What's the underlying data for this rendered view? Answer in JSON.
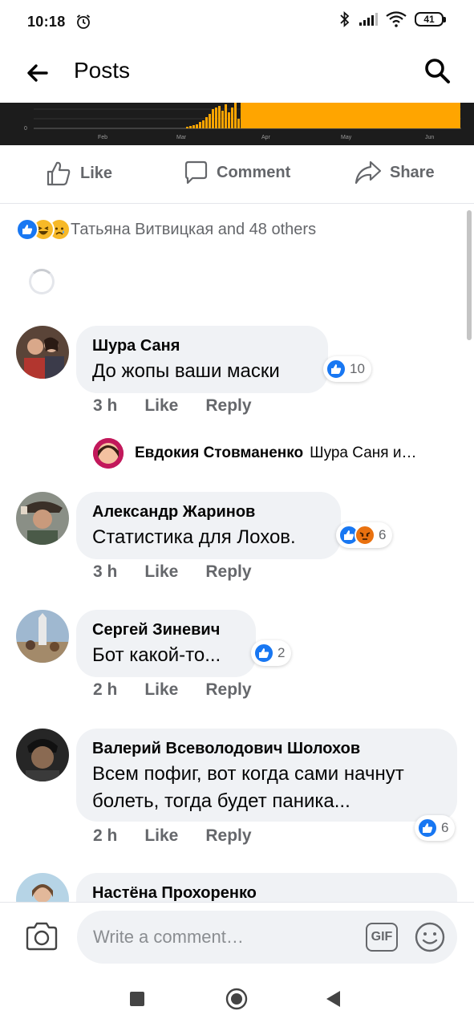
{
  "status_bar": {
    "time": "10:18",
    "battery": "41",
    "icons": [
      "alarm-icon",
      "bluetooth-icon",
      "signal-icon",
      "wifi-icon",
      "battery-icon"
    ]
  },
  "app_bar": {
    "title": "Posts",
    "icons": [
      "back-arrow-icon",
      "search-icon"
    ]
  },
  "chart_data": {
    "type": "bar",
    "title": "",
    "xlabel": "",
    "ylabel": "",
    "tick_labels_x": [
      "Feb",
      "Mar",
      "Apr",
      "May",
      "Jun"
    ],
    "tick_labels_y": [
      "0"
    ],
    "colors": {
      "bars": "#FFA500",
      "background": "#1c1c1c",
      "grid": "#3a3a3a"
    }
  },
  "actions": {
    "like": "Like",
    "comment": "Comment",
    "share": "Share"
  },
  "reactions_summary": {
    "text": "Татьяна Витвицкая and 48 others",
    "icons": [
      "like-reaction-icon",
      "haha-reaction-icon",
      "sad-reaction-icon"
    ]
  },
  "comments": [
    {
      "author": "Шура Саня",
      "text": "До жопы ваши маски",
      "time": "3 h",
      "like": "Like",
      "reply": "Reply",
      "reaction_count": "10",
      "reactions": [
        "like"
      ],
      "replies": [
        {
          "author": "Евдокия Стовманенко",
          "text": "Шура Саня и…"
        }
      ]
    },
    {
      "author": "Александр Жаринов",
      "text": "Статистика для Лохов.",
      "time": "3 h",
      "like": "Like",
      "reply": "Reply",
      "reaction_count": "6",
      "reactions": [
        "like",
        "angry"
      ]
    },
    {
      "author": "Сергей Зиневич",
      "text": "Бот какой-то...",
      "time": "2 h",
      "like": "Like",
      "reply": "Reply",
      "reaction_count": "2",
      "reactions": [
        "like"
      ]
    },
    {
      "author": "Валерий Всеволодович Шолохов",
      "text_line1": "Всем пофиг, вот когда сами начнут",
      "text_line2": "болеть, тогда будет паника...",
      "time": "2 h",
      "like": "Like",
      "reply": "Reply",
      "reaction_count": "6",
      "reactions": [
        "like"
      ]
    },
    {
      "author": "Настёна Прохоренко"
    }
  ],
  "composer": {
    "placeholder": "Write a comment…",
    "gif_label": "GIF"
  },
  "navbar": {
    "icons": [
      "recents-square-icon",
      "home-circle-icon",
      "back-triangle-icon"
    ]
  }
}
